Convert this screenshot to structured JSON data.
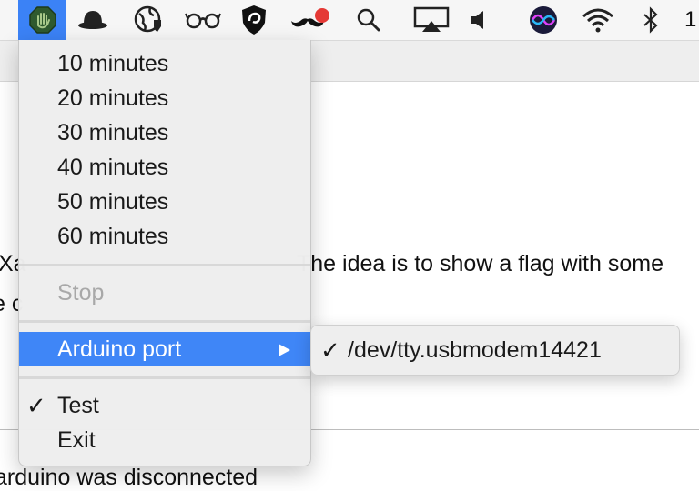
{
  "menubar": {
    "icons": [
      "hand-icon",
      "bowler-hat-icon",
      "globe-shield-icon",
      "glasses-icon",
      "shield-swirl-icon",
      "mustache-icon",
      "search-icon",
      "airplay-icon",
      "volume-icon",
      "siri-icon",
      "wifi-icon",
      "bluetooth-icon"
    ],
    "clock_partial": "1",
    "accent": "#3b82f6",
    "notification_dot_color": "#e53935"
  },
  "background": {
    "line1_left": "Xa",
    "line1_right": "The idea is to show a flag with some",
    "line2_fragment": "e c",
    "bottom_text": "arduino was disconnected"
  },
  "menu": {
    "durations": [
      "10 minutes",
      "20 minutes",
      "30 minutes",
      "40 minutes",
      "50 minutes",
      "60 minutes"
    ],
    "stop": "Stop",
    "arduino_port": "Arduino port",
    "test": "Test",
    "test_check": "✓",
    "exit": "Exit"
  },
  "submenu": {
    "check": "✓",
    "port": "/dev/tty.usbmodem14421"
  }
}
